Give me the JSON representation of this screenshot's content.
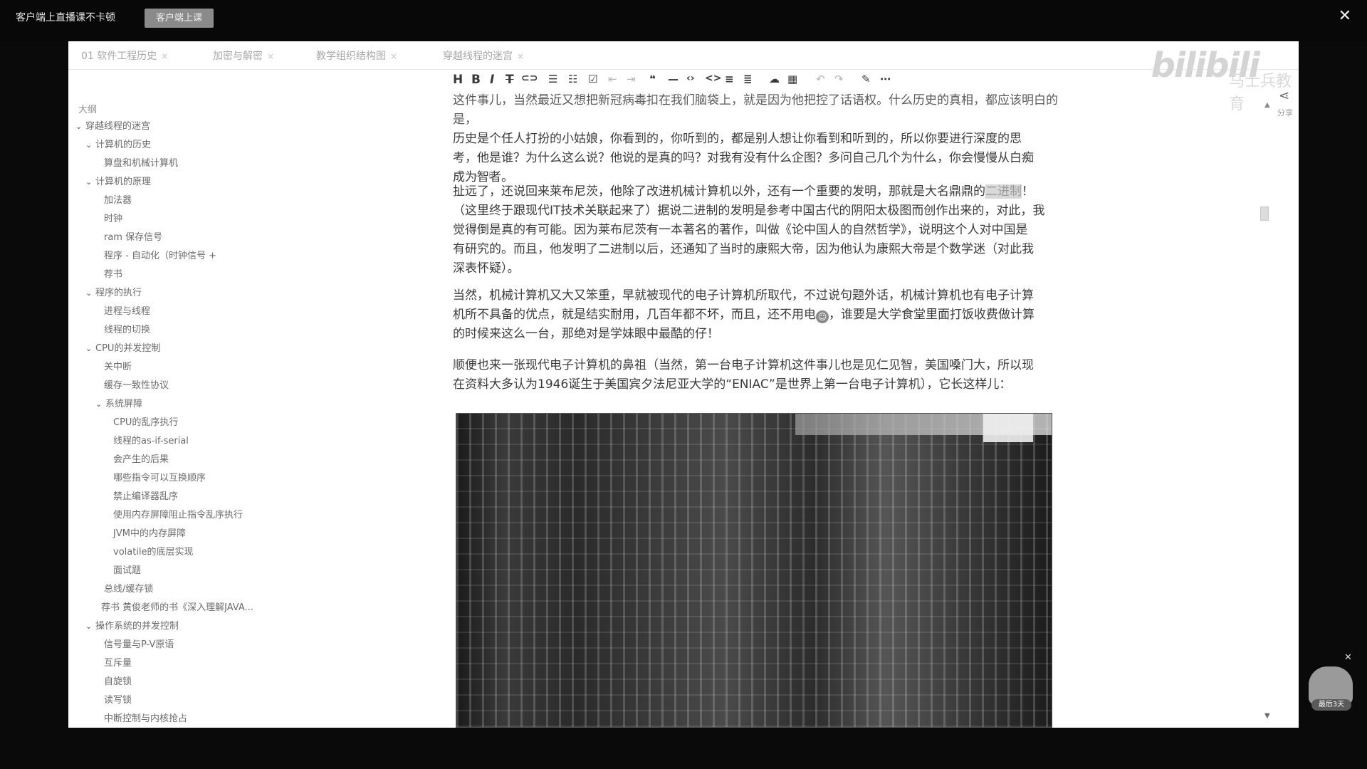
{
  "topbar": {
    "promo_text": "客户端上直播课不卡顿",
    "promo_button": "客户端上课",
    "close_icon": "close-icon"
  },
  "tabs": [
    {
      "label": "01 软件工程历史"
    },
    {
      "label": "加密与解密"
    },
    {
      "label": "教学组织结构图"
    },
    {
      "label": "穿越线程的迷宫"
    }
  ],
  "logo": {
    "text": "bilibili",
    "watermark": "马士兵教育"
  },
  "outline": {
    "title": "大纲",
    "items": [
      {
        "label": "穿越线程的迷宫",
        "caret": "⌄"
      },
      {
        "label": "计算机的历史",
        "caret": "⌄"
      },
      {
        "label": "算盘和机械计算机",
        "caret": ""
      },
      {
        "label": "计算机的原理",
        "caret": "⌄"
      },
      {
        "label": "加法器",
        "caret": ""
      },
      {
        "label": "时钟",
        "caret": ""
      },
      {
        "label": "ram 保存信号",
        "caret": ""
      },
      {
        "label": "程序 - 自动化（时钟信号 +",
        "caret": ""
      },
      {
        "label": "荐书",
        "caret": ""
      },
      {
        "label": "程序的执行",
        "caret": "⌄"
      },
      {
        "label": "进程与线程",
        "caret": ""
      },
      {
        "label": "线程的切换",
        "caret": ""
      },
      {
        "label": "CPU的并发控制",
        "caret": "⌄"
      },
      {
        "label": "关中断",
        "caret": ""
      },
      {
        "label": "缓存一致性协议",
        "caret": ""
      },
      {
        "label": "系统屏障",
        "caret": "⌄"
      },
      {
        "label": "CPU的乱序执行",
        "caret": ""
      },
      {
        "label": "线程的as-if-serial",
        "caret": ""
      },
      {
        "label": "会产生的后果",
        "caret": ""
      },
      {
        "label": "哪些指令可以互换顺序",
        "caret": ""
      },
      {
        "label": "禁止编译器乱序",
        "caret": ""
      },
      {
        "label": "使用内存屏障阻止指令乱序执行",
        "caret": ""
      },
      {
        "label": "JVM中的内存屏障",
        "caret": ""
      },
      {
        "label": "volatile的底层实现",
        "caret": ""
      },
      {
        "label": "面试题",
        "caret": ""
      },
      {
        "label": "总线/缓存锁",
        "caret": ""
      },
      {
        "label": "荐书 黄俊老师的书《深入理解JAVA...",
        "caret": ""
      },
      {
        "label": "操作系统的并发控制",
        "caret": "⌄"
      },
      {
        "label": "信号量与P-V原语",
        "caret": ""
      },
      {
        "label": "互斥量",
        "caret": ""
      },
      {
        "label": "自旋锁",
        "caret": ""
      },
      {
        "label": "读写锁",
        "caret": ""
      },
      {
        "label": "中断控制与内核抢占",
        "caret": ""
      }
    ]
  },
  "toolbar": {
    "icons": [
      "heading-icon",
      "bold-icon",
      "italic-icon",
      "strikethrough-icon",
      "link-icon",
      "bullet-list-icon",
      "ordered-list-icon",
      "checkbox-list-icon",
      "indent-decrease-icon",
      "indent-increase-icon",
      "quote-icon",
      "horizontal-rule-icon",
      "code-icon",
      "code-block-icon",
      "align-icon",
      "toc-icon",
      "cloud-icon",
      "table-icon",
      "undo-icon",
      "redo-icon",
      "pen-icon",
      "more-icon"
    ]
  },
  "share": {
    "label": "分享"
  },
  "article": {
    "p1_line1": "这件事儿，当然最近又想把新冠病毒扣在我们脑袋上，就是因为他把控了话语权。什么历史的真相，都应该明白的是，",
    "p1_line2": "历史是个任人打扮的小姑娘，你看到的，你听到的，都是别人想让你看到和听到的，所以你要进行深度的思",
    "p1_line3": "考，他是谁？为什么这么说？他说的是真的吗？对我有没有什么企图？多问自己几个为什么，你会慢慢从白痴",
    "p1_line4": "成为智者。",
    "p2_before": "扯远了，还说回来莱布尼茨，他除了改进机械计算机以外，还有一个重要的发明，那就是大名鼎鼎的",
    "p2_highlight": "二进制",
    "p2_after": "！",
    "p2_line2": "（这里终于跟现代IT技术关联起来了）据说二进制的发明是参考中国古代的阴阳太极图而创作出来的，对此，我",
    "p2_line3": "觉得倒是真的有可能。因为莱布尼茨有一本著名的著作，叫做《论中国人的自然哲学》，说明这个人对中国是",
    "p2_line4": "有研究的。而且，他发明了二进制以后，还通知了当时的康熙大帝，因为他认为康熙大帝是个数学迷（对此我",
    "p2_line5": "深表怀疑）。",
    "p3_line1": "当然，机械计算机又大又笨重，早就被现代的电子计算机所取代，不过说句题外话，机械计算机也有电子计算",
    "p3_line2_before": "机所不具备的优点，就是结实耐用，几百年都不坏，而且，还不用电",
    "p3_line2_after": "，谁要是大学食堂里面打饭收费做计算",
    "p3_line3": "的时候来这么一台，那绝对是学妹眼中最酷的仔！",
    "p4_line1": "顺便也来一张现代电子计算机的鼻祖（当然，第一台电子计算机这件事儿也是见仁见智，美国嗓门大，所以现",
    "p4_line2": "在资料大多认为1946诞生于美国宾夕法尼亚大学的“ENIAC”是世界上第一台电子计算机），它长这样儿："
  },
  "mascot": {
    "label": "最后3天"
  }
}
